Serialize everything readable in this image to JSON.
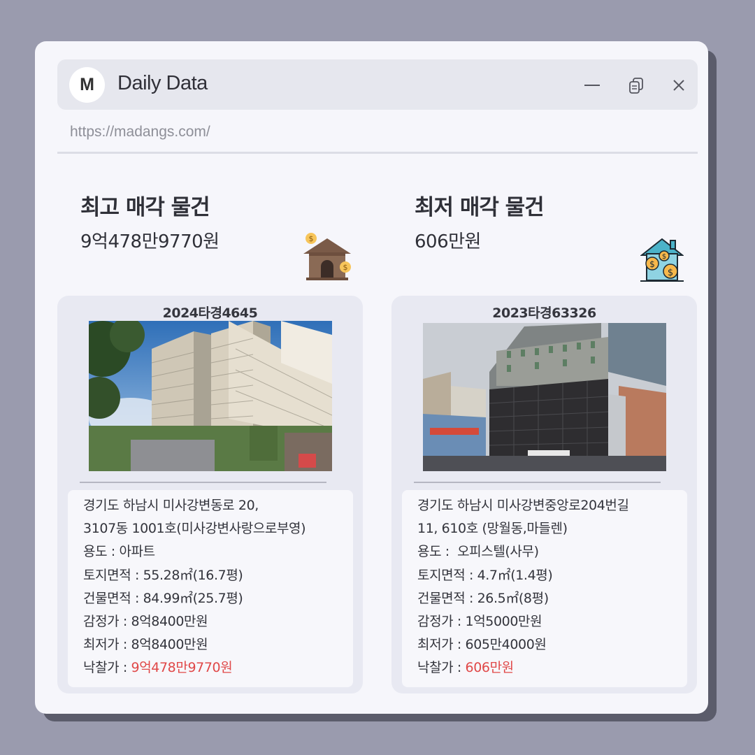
{
  "window": {
    "logo_letter": "M",
    "title": "Daily Data",
    "url": "https://madangs.com/"
  },
  "icons": [
    "minimize-icon",
    "copy-icon",
    "close-icon",
    "house-coin-icon",
    "house-money-icon"
  ],
  "colors": {
    "background": "#9a9bae",
    "highlight": "#e04848",
    "card": "#e8e9f2"
  },
  "highest": {
    "heading": "최고 매각 물건",
    "price": "9억478만9770원",
    "case_no": "2024타경4645",
    "address_line1": "경기도 하남시 미사강변동로 20,",
    "address_line2": "3107동 1001호(미사강변사랑으로부영)",
    "usage_label": "용도 : ",
    "usage": "아파트",
    "land_label": "토지면적 : ",
    "land_area": "55.28㎡(16.7평)",
    "building_label": "건물면적 : ",
    "building_area": "84.99㎡(25.7평)",
    "appraisal_label": "감정가 : ",
    "appraisal": "8억8400만원",
    "minimum_label": "최저가 : ",
    "minimum": "8억8400만원",
    "winning_label": "낙찰가 : ",
    "winning": "9억478만9770원"
  },
  "lowest": {
    "heading": "최저 매각 물건",
    "price": "606만원",
    "case_no": "2023타경63326",
    "address_line1": "경기도 하남시 미사강변중앙로204번길",
    "address_line2": "11, 610호 (망월동,마들렌)",
    "usage_label": "용도 :  ",
    "usage": "오피스텔(사무)",
    "land_label": "토지면적 : ",
    "land_area": "4.7㎡(1.4평)",
    "building_label": "건물면적 : ",
    "building_area": "26.5㎡(8평)",
    "appraisal_label": "감정가 : ",
    "appraisal": "1억5000만원",
    "minimum_label": "최저가 : ",
    "minimum": "605만4000원",
    "winning_label": "낙찰가 : ",
    "winning": "606만원"
  }
}
